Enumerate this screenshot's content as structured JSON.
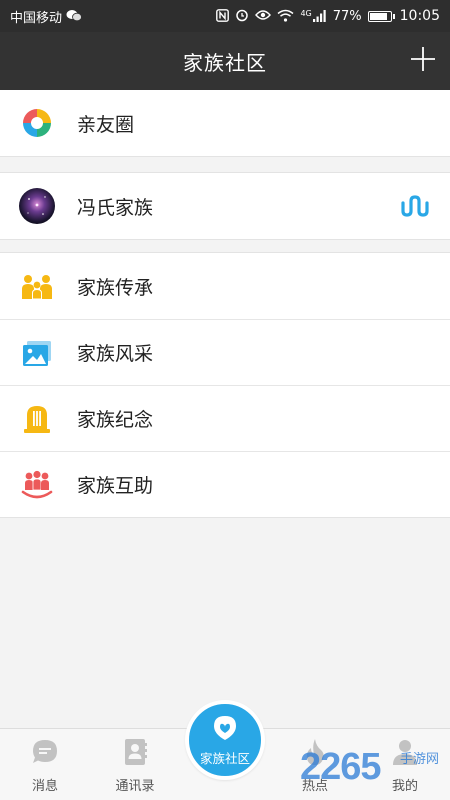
{
  "status_bar": {
    "carrier": "中国移动",
    "network": "4G",
    "battery": "77%",
    "battery_level": 0.77,
    "time": "10:05"
  },
  "header": {
    "title": "家族社区",
    "action_icon": "plus-icon"
  },
  "sections": [
    {
      "items": [
        {
          "label": "亲友圈",
          "icon": "friends-circle-icon"
        }
      ]
    },
    {
      "items": [
        {
          "label": "冯氏家族",
          "icon": "galaxy-avatar",
          "trailing_icon": "wave-icon",
          "trailing_color": "#29a7e6"
        }
      ]
    },
    {
      "items": [
        {
          "label": "家族传承",
          "icon": "family-people-icon",
          "color": "#f6b813"
        },
        {
          "label": "家族风采",
          "icon": "photo-icon",
          "color": "#29a7e6"
        },
        {
          "label": "家族纪念",
          "icon": "memorial-icon",
          "color": "#f6b813"
        },
        {
          "label": "家族互助",
          "icon": "mutual-help-icon",
          "color": "#ec5a5a"
        }
      ]
    }
  ],
  "tabbar": {
    "tabs": [
      {
        "label": "消息",
        "icon": "chat-bubble-icon"
      },
      {
        "label": "通讯录",
        "icon": "contacts-icon"
      },
      {
        "label": "家族社区",
        "icon": "community-icon",
        "active": true
      },
      {
        "label": "热点",
        "icon": "flame-icon"
      },
      {
        "label": "我的",
        "icon": "profile-icon"
      }
    ]
  },
  "watermark": {
    "number": "2265",
    "text": "手游网"
  },
  "colors": {
    "accent": "#29a7e6",
    "header_bg": "#333333",
    "status_bg": "#2e2e2e",
    "page_bg": "#f3f3f3"
  }
}
